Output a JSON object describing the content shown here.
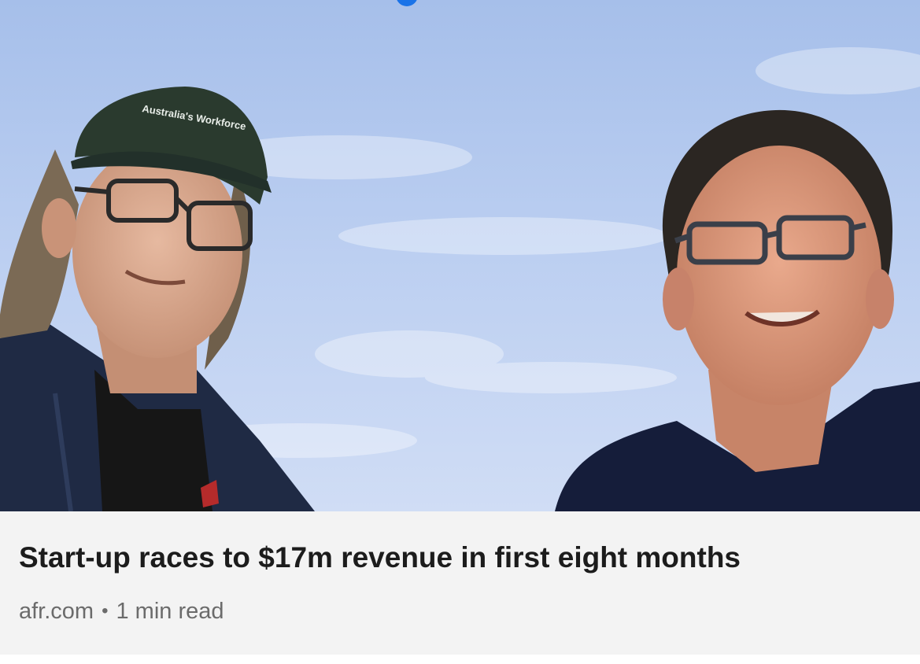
{
  "article": {
    "headline": "Start-up races to $17m revenue in first eight months",
    "source": "afr.com",
    "separator": "•",
    "read_time": "1 min read",
    "cap_text": "Australia's Workforce"
  },
  "image": {
    "description_icon": "photo-icon"
  },
  "colors": {
    "caption_background": "#f3f3f3",
    "headline_color": "#1c1c1c",
    "meta_color": "#6b6b6b",
    "scroll_indicator": "#1a73e8"
  }
}
